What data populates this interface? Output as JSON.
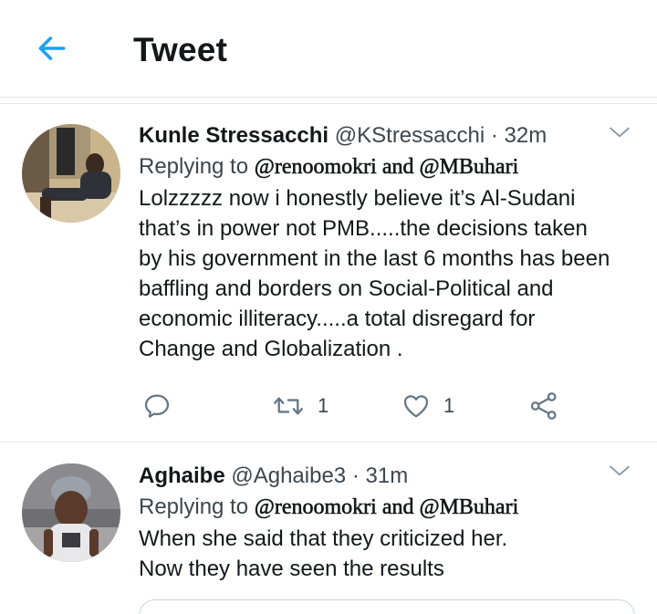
{
  "header": {
    "title": "Tweet"
  },
  "tweets": [
    {
      "name": "Kunle Stressacchi",
      "handle": "@KStressacchi",
      "dot": "·",
      "time": "32m",
      "replying_prefix": "Replying to",
      "replying_to": "@renoomokri and @MBuhari",
      "text_lines": [
        "Lolzzzzz now i honestly believe it’s Al-Sudani",
        "that’s in power not PMB.....the decisions taken",
        "by his government in the last 6 months has been",
        "baffling and borders on Social-Political and",
        "economic illiteracy.....a total disregard for",
        "Change and Globalization ."
      ],
      "retweet_count": "1",
      "like_count": "1"
    },
    {
      "name": "Aghaibe",
      "handle": "@Aghaibe3",
      "dot": "·",
      "time": "31m",
      "replying_prefix": "Replying to",
      "replying_to": "@renoomokri and @MBuhari",
      "text_lines": [
        "When she said that they criticized her.",
        "Now they have seen the results"
      ]
    }
  ],
  "icons": {
    "back": "arrow-left-icon",
    "caret": "chevron-down-icon",
    "reply": "reply-icon",
    "retweet": "retweet-icon",
    "like": "heart-icon",
    "share": "share-icon"
  },
  "colors": {
    "accent": "#1da1f2",
    "icon_gray": "#657786",
    "divider": "#e1e8ed"
  }
}
